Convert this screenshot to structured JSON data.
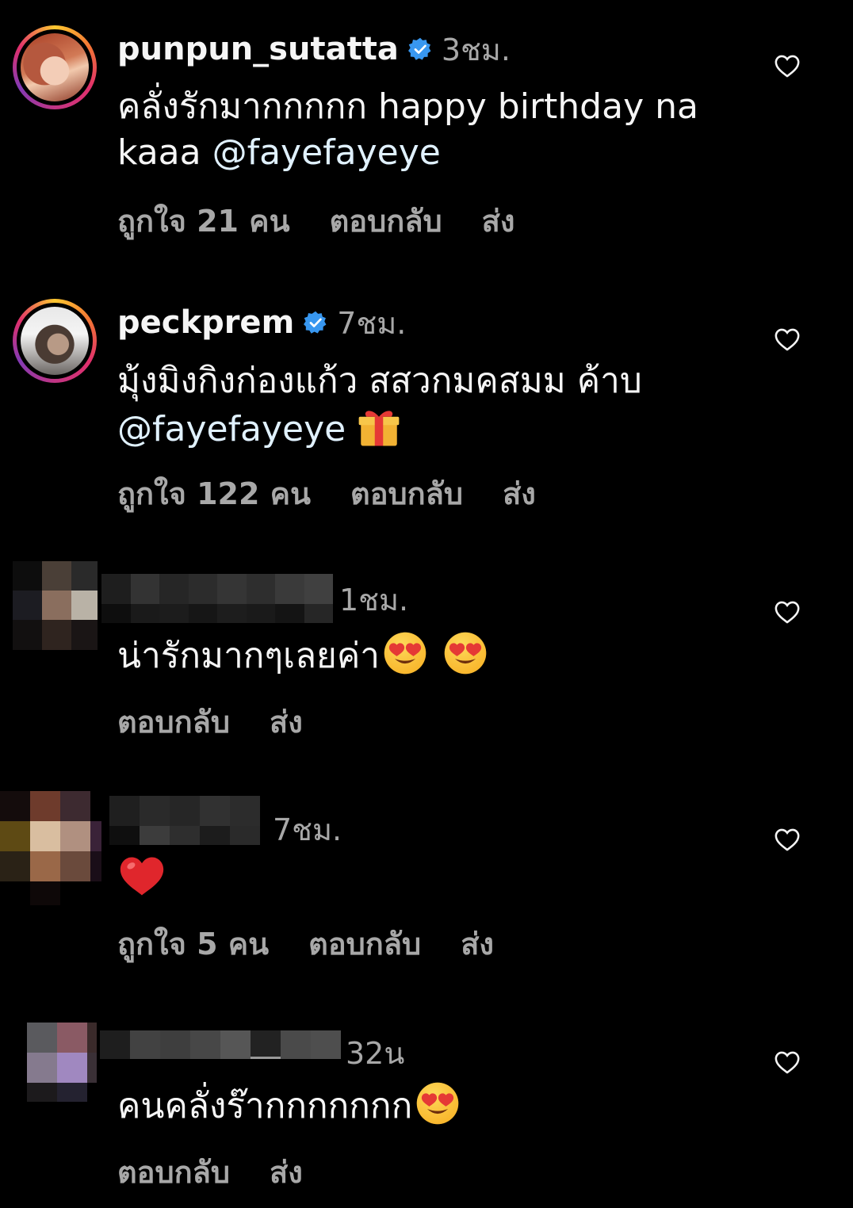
{
  "comments": [
    {
      "username": "punpun_sutatta",
      "verified": true,
      "time": "3ชม.",
      "text": "คลั่งรักมากกกกก  happy birthday na kaaa ",
      "mention": "@fayefayeye",
      "likes": "ถูกใจ 21 คน",
      "reply": "ตอบกลับ",
      "send": "ส่ง"
    },
    {
      "username": "peckprem",
      "verified": true,
      "time": "7ชม.",
      "text": "มุ้งมิงกิงก่องแก้ว สสวกมคสมม ค้าบ",
      "mention": "@fayefayeye",
      "emoji": "gift-emoji",
      "likes": "ถูกใจ 122 คน",
      "reply": "ตอบกลับ",
      "send": "ส่ง"
    },
    {
      "username": "",
      "verified": false,
      "time": "1ชม.",
      "text": "น่ารักมากๆเลยค่า",
      "emoji": "heart-eyes-emoji x2",
      "reply": "ตอบกลับ",
      "send": "ส่ง"
    },
    {
      "username": "",
      "verified": false,
      "time": "7ชม.",
      "text": "",
      "emoji": "red-heart-emoji",
      "likes": "ถูกใจ 5 คน",
      "reply": "ตอบกลับ",
      "send": "ส่ง"
    },
    {
      "username": "",
      "verified": false,
      "time": "32น",
      "text": "คนคลั่งร๊ากกกกกกก",
      "emoji": "heart-eyes-emoji",
      "reply": "ตอบกลับ",
      "send": "ส่ง"
    }
  ],
  "colors": {
    "background": "#000000",
    "text": "#f5f5f5",
    "secondary": "#a8a8a8",
    "verified": "#3897f0",
    "mention": "#e0f1ff"
  }
}
